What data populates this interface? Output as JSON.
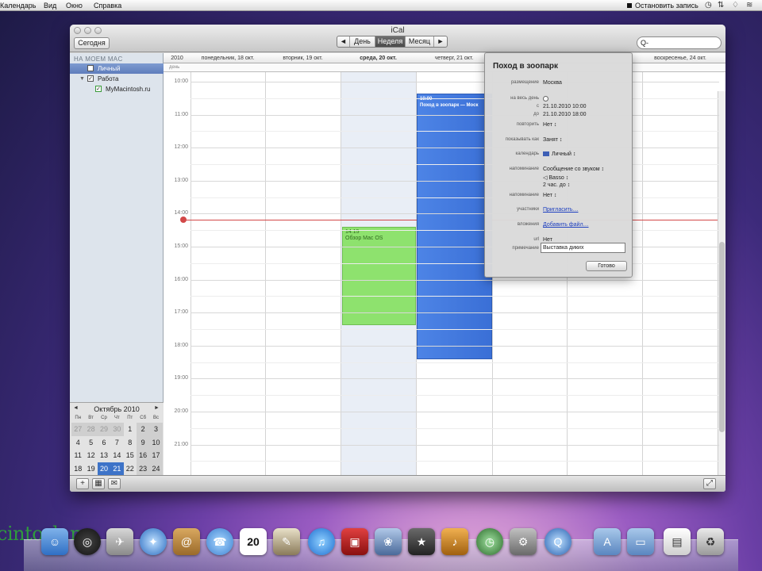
{
  "menubar": {
    "items": [
      "Календарь",
      "Вид",
      "Окно",
      "Справка"
    ],
    "recording": "Остановить запись"
  },
  "window": {
    "title": "iCal",
    "today_button": "Сегодня",
    "views": [
      "День",
      "Неделя",
      "Месяц"
    ],
    "selected_view": "Неделя",
    "search_placeholder": "Q-"
  },
  "sidebar": {
    "header": "НА МОЕМ MAC",
    "items": [
      {
        "label": "Личный",
        "selected": true
      },
      {
        "label": "Работа",
        "selected": false
      },
      {
        "label": "MyMacintosh.ru",
        "selected": false
      }
    ]
  },
  "mini_calendar": {
    "title": "Октябрь 2010",
    "prev": "◄",
    "next": "►",
    "weekdays": [
      "Пн",
      "Вт",
      "Ср",
      "Чт",
      "Пт",
      "Сб",
      "Вс"
    ],
    "rows": [
      [
        "27",
        "28",
        "29",
        "30",
        "1",
        "2",
        "3"
      ],
      [
        "4",
        "5",
        "6",
        "7",
        "8",
        "9",
        "10"
      ],
      [
        "11",
        "12",
        "13",
        "14",
        "15",
        "16",
        "17"
      ],
      [
        "18",
        "19",
        "20",
        "21",
        "22",
        "23",
        "24"
      ],
      [
        "25",
        "26",
        "27",
        "28",
        "29",
        "30",
        "31"
      ],
      [
        "1",
        "2",
        "3",
        "4",
        "5",
        "6",
        "7"
      ]
    ],
    "highlighted": [
      "20",
      "21"
    ]
  },
  "calendar": {
    "year": "2010",
    "allday_label": "день",
    "days": [
      "понедельник, 18 окт.",
      "вторник, 19 окт.",
      "среда, 20 окт.",
      "четверг, 21 окт.",
      "",
      "",
      "воскресенье, 24 окт."
    ],
    "hours": [
      "10:00",
      "11:00",
      "12:00",
      "13:00",
      "14:00",
      "15:00",
      "16:00",
      "17:00",
      "18:00",
      "19:00",
      "20:00",
      "21:00"
    ],
    "events": {
      "green": {
        "time": "14:15",
        "title": "Обзор Mac OS"
      },
      "blue": {
        "time": "10:00",
        "title": "Поход в зоопарк — Моск"
      }
    }
  },
  "popover": {
    "title": "Поход в зоопарк",
    "fields": [
      {
        "label": "размещение",
        "value": "Москва"
      },
      {
        "label": "на весь день",
        "value": ""
      },
      {
        "label": "с",
        "value": "21.10.2010 10:00"
      },
      {
        "label": "до",
        "value": "21.10.2010 18:00"
      },
      {
        "label": "повторить",
        "value": "Нет ↕"
      },
      {
        "label": "показывать как",
        "value": "Занят ↕"
      },
      {
        "label": "календарь",
        "value": "Личный ↕"
      },
      {
        "label": "напоминание",
        "value": "Сообщение со звуком ↕"
      },
      {
        "label": "",
        "value": "◁ Basso ↕"
      },
      {
        "label": "",
        "value": "2 час. до ↕"
      },
      {
        "label": "напоминание",
        "value": "Нет ↕"
      },
      {
        "label": "участники",
        "value": "Пригласить…"
      },
      {
        "label": "вложения",
        "value": "Добавить файл…"
      },
      {
        "label": "url",
        "value": "Нет"
      },
      {
        "label": "примечание",
        "value": "Выставка диких"
      }
    ],
    "done_button": "Готово"
  },
  "watermark": "cintosh.ru",
  "dock": {
    "calendar_day": "20"
  }
}
